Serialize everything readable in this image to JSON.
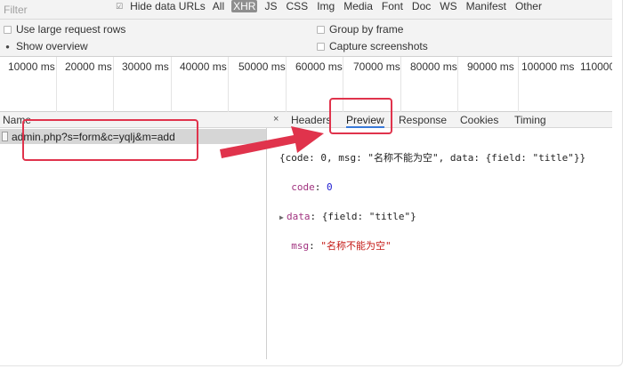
{
  "filter": {
    "placeholder": "Filter",
    "hide_data_urls": "Hide data URLs",
    "types": [
      "All",
      "XHR",
      "JS",
      "CSS",
      "Img",
      "Media",
      "Font",
      "Doc",
      "WS",
      "Manifest",
      "Other"
    ],
    "active_type": "XHR"
  },
  "options": {
    "large_rows": "Use large request rows",
    "overview": "Show overview",
    "group_frame": "Group by frame",
    "capture": "Capture screenshots"
  },
  "timeline": {
    "ticks": [
      "10000 ms",
      "20000 ms",
      "30000 ms",
      "40000 ms",
      "50000 ms",
      "60000 ms",
      "70000 ms",
      "80000 ms",
      "90000 ms",
      "100000 ms",
      "110000"
    ]
  },
  "requests": {
    "header": "Name",
    "rows": [
      {
        "name": "admin.php?s=form&c=yqlj&m=add"
      }
    ]
  },
  "detail": {
    "close": "×",
    "tabs": [
      "Headers",
      "Preview",
      "Response",
      "Cookies",
      "Timing"
    ],
    "active_tab": "Preview",
    "preview": {
      "summary_visible": "{code: 0, msg: \"名称不能为空\", data: {field: \"title\"}}",
      "code_key": "code",
      "code_value": "0",
      "data_key": "data",
      "data_value": "{field: \"title\"}",
      "msg_key": "msg",
      "msg_value": "\"名称不能为空\""
    }
  },
  "colors": {
    "annotation": "#e0334c",
    "active_tab_underline": "#3879d9"
  }
}
